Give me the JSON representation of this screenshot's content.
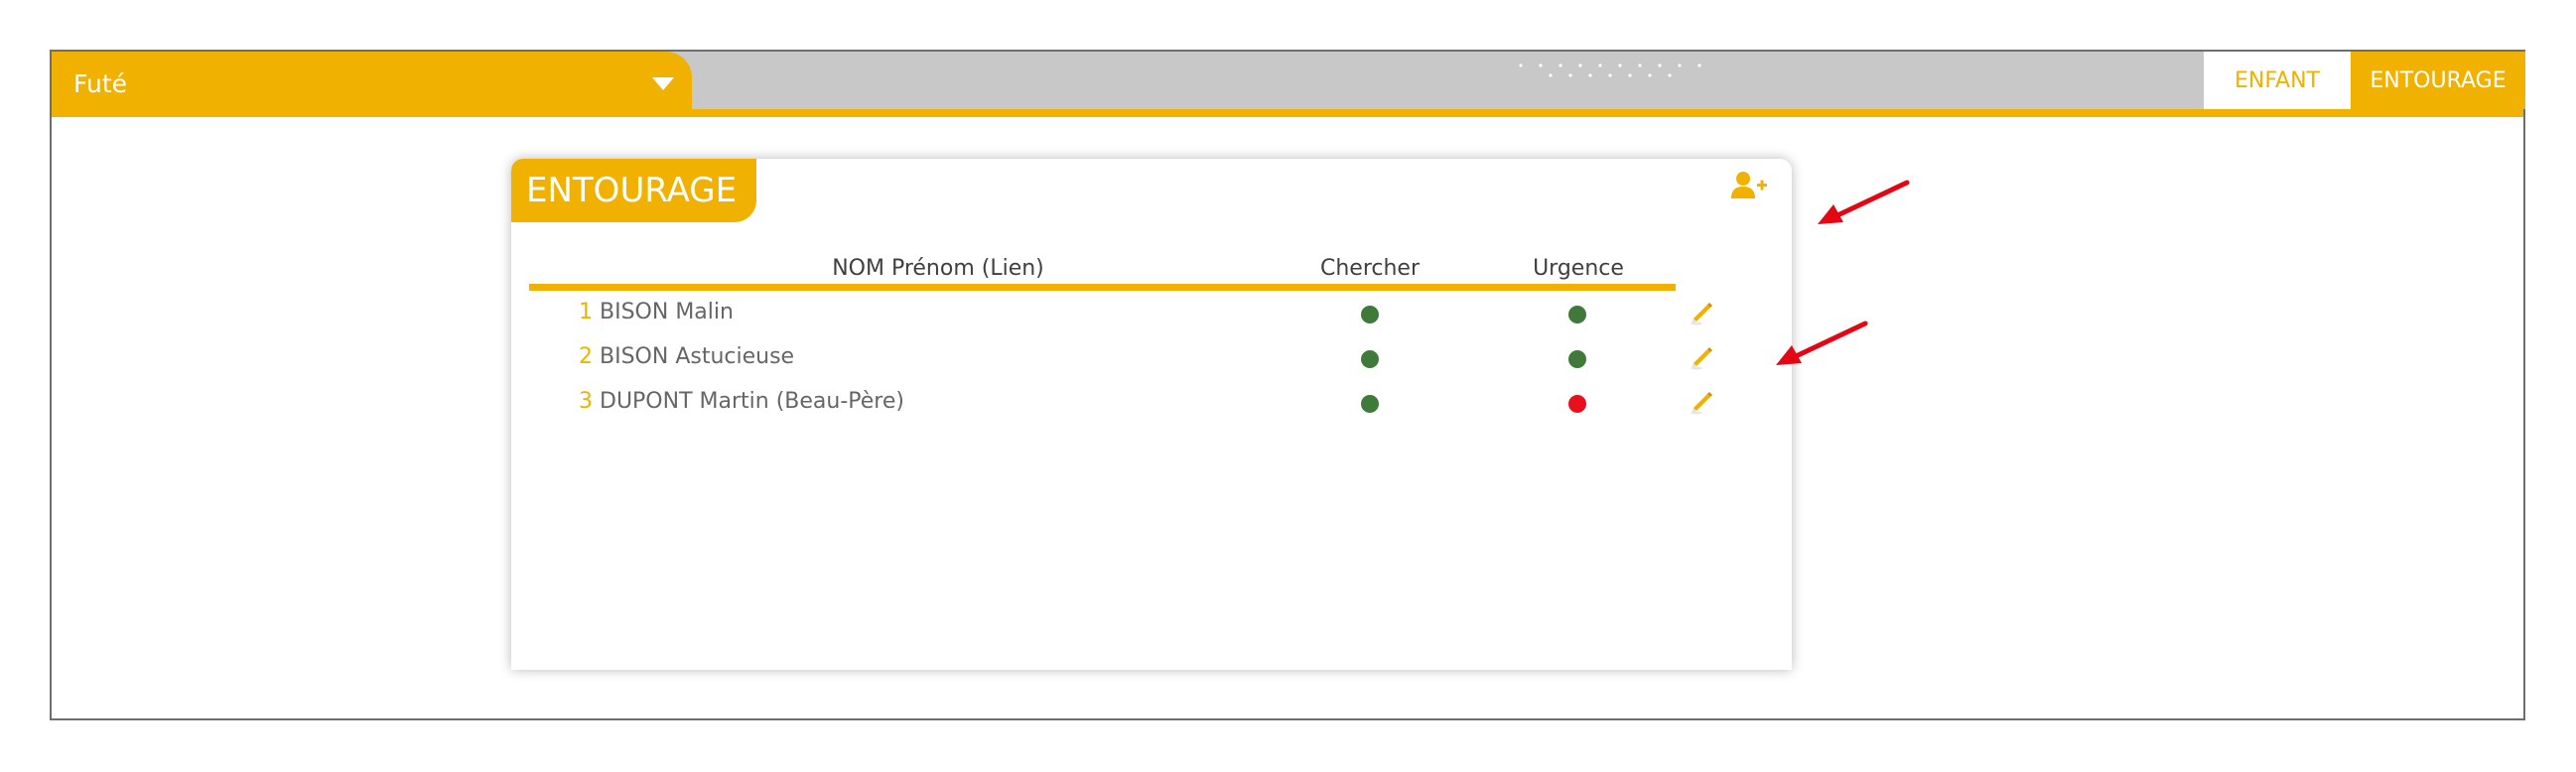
{
  "topbar": {
    "child_name": "Futé",
    "tabs": [
      "ENFANT",
      "ENTOURAGE"
    ]
  },
  "card": {
    "title": "ENTOURAGE",
    "headers": {
      "name": "NOM Prénom (Lien)",
      "chercher": "Chercher",
      "urgence": "Urgence"
    },
    "rows": [
      {
        "index": "1",
        "name": "BISON Malin",
        "chercher": "green",
        "urgence": "green"
      },
      {
        "index": "2",
        "name": "BISON Astucieuse",
        "chercher": "green",
        "urgence": "green"
      },
      {
        "index": "3",
        "name": "DUPONT Martin (Beau-Père)",
        "chercher": "green",
        "urgence": "red"
      }
    ]
  },
  "colors": {
    "accent": "#f0b100",
    "topbar_gray": "#c8c8c8",
    "status_green": "#3f7a3a",
    "status_red": "#e8101a",
    "annotation_arrow": "#e30613"
  },
  "icons": [
    "chevron-down-icon",
    "add-person-icon",
    "pencil-icon",
    "arrow-annotation"
  ]
}
